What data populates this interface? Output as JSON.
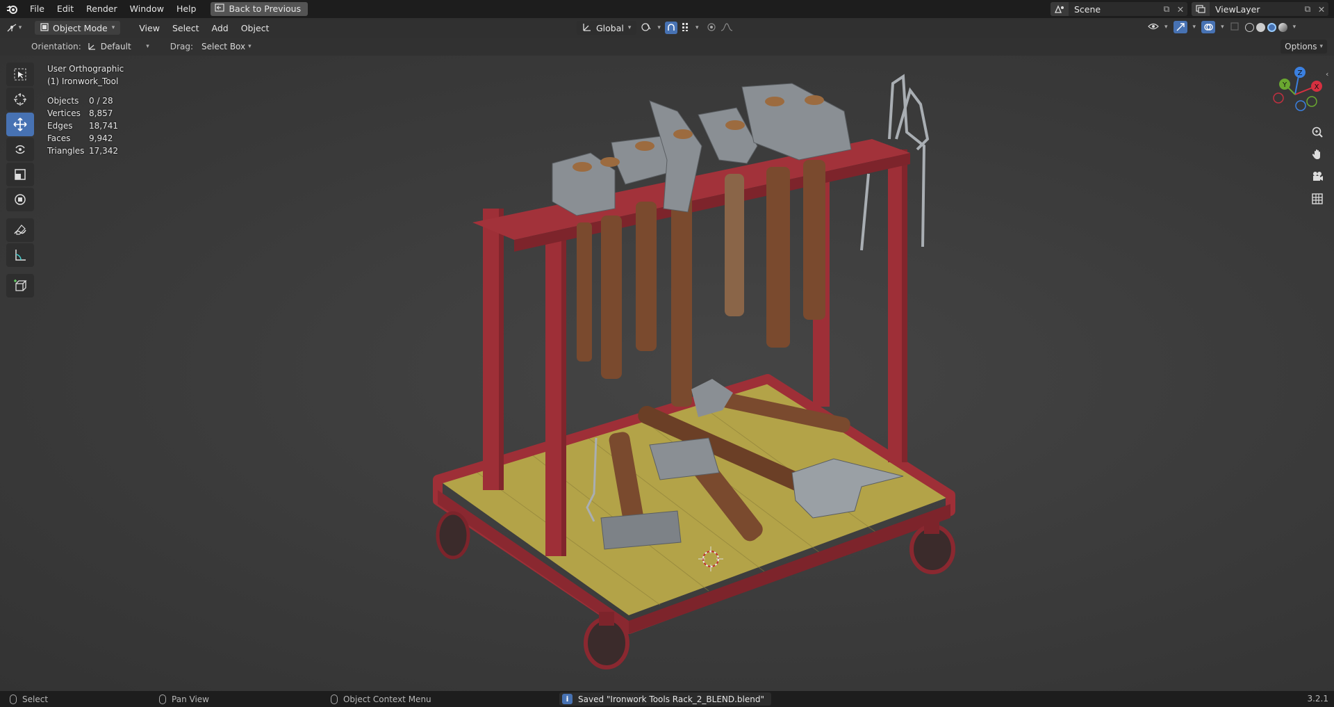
{
  "menu": {
    "items": [
      "File",
      "Edit",
      "Render",
      "Window",
      "Help"
    ],
    "back_button": "Back to Previous"
  },
  "scene": {
    "name": "Scene",
    "view_layer": "ViewLayer"
  },
  "header": {
    "mode": "Object Mode",
    "menus": [
      "View",
      "Select",
      "Add",
      "Object"
    ],
    "transform_orientation": "Global",
    "options": "Options"
  },
  "subheader": {
    "orientation_label": "Orientation:",
    "orientation_value": "Default",
    "drag_label": "Drag:",
    "drag_value": "Select Box"
  },
  "viewport": {
    "view_name": "User Orthographic",
    "active_object": "(1) Ironwork_Tool",
    "stats": [
      {
        "label": "Objects",
        "value": "0 / 28"
      },
      {
        "label": "Vertices",
        "value": "8,857"
      },
      {
        "label": "Edges",
        "value": "18,741"
      },
      {
        "label": "Faces",
        "value": "9,942"
      },
      {
        "label": "Triangles",
        "value": "17,342"
      }
    ]
  },
  "gizmo": {
    "x": "X",
    "y": "Y",
    "z": "Z"
  },
  "status": {
    "select": "Select",
    "pan": "Pan View",
    "context": "Object Context Menu",
    "message": "Saved \"Ironwork Tools Rack_2_BLEND.blend\"",
    "version": "3.2.1"
  },
  "colors": {
    "accent": "#4772b3",
    "rack_red": "#9e2f37",
    "board_yellow": "#b9a84a",
    "wood": "#7a4a2e",
    "steel": "#8a8f94"
  }
}
